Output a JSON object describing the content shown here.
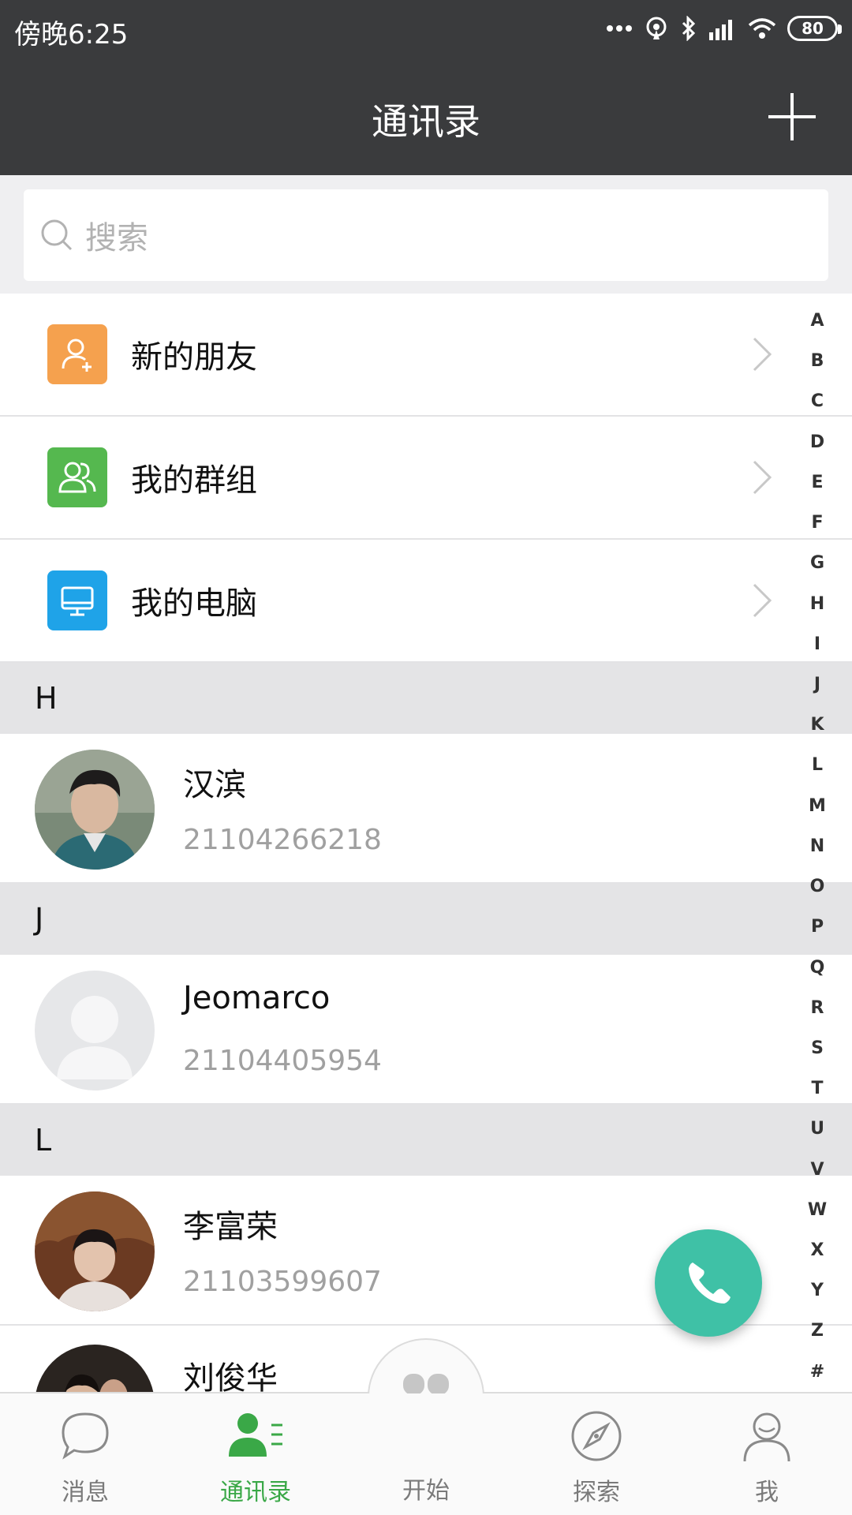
{
  "status_bar": {
    "time": "傍晚6:25",
    "battery": "80"
  },
  "header": {
    "title": "通讯录"
  },
  "search": {
    "placeholder": "搜索"
  },
  "menu": [
    {
      "label": "新的朋友",
      "icon": "add-user-icon",
      "color": "#f5a14e"
    },
    {
      "label": "我的群组",
      "icon": "group-icon",
      "color": "#55b84f"
    },
    {
      "label": "我的电脑",
      "icon": "computer-icon",
      "color": "#1fa3e8"
    }
  ],
  "sections": [
    {
      "letter": "H",
      "contacts": [
        {
          "name": "汉滨",
          "phone": "21104266218"
        }
      ]
    },
    {
      "letter": "J",
      "contacts": [
        {
          "name": "Jeomarco",
          "phone": "21104405954"
        }
      ]
    },
    {
      "letter": "L",
      "contacts": [
        {
          "name": "李富荣",
          "phone": "21103599607"
        },
        {
          "name": "刘俊华",
          "phone": ""
        }
      ]
    }
  ],
  "alphabet": [
    "A",
    "B",
    "C",
    "D",
    "E",
    "F",
    "G",
    "H",
    "I",
    "J",
    "K",
    "L",
    "M",
    "N",
    "O",
    "P",
    "Q",
    "R",
    "S",
    "T",
    "U",
    "V",
    "W",
    "X",
    "Y",
    "Z",
    "#"
  ],
  "tabs": [
    {
      "label": "消息",
      "icon": "chat-bubble-icon",
      "active": false
    },
    {
      "label": "通讯录",
      "icon": "contacts-icon",
      "active": true
    },
    {
      "label": "开始",
      "icon": "clover-icon",
      "active": false
    },
    {
      "label": "探索",
      "icon": "compass-icon",
      "active": false
    },
    {
      "label": "我",
      "icon": "profile-icon",
      "active": false
    }
  ],
  "colors": {
    "header_bg": "#3a3b3d",
    "accent_green": "#3aa847",
    "fab": "#3fc1a6"
  }
}
